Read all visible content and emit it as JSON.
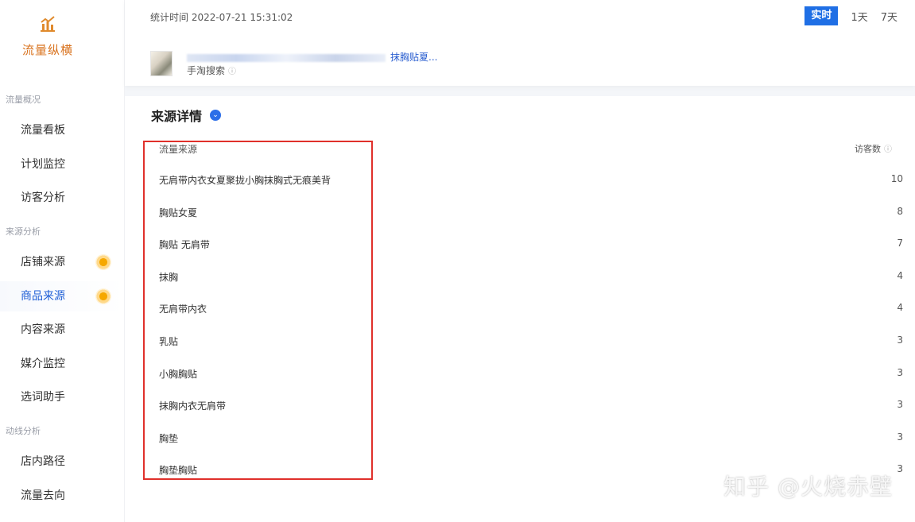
{
  "sidebar": {
    "brand_title": "流量纵横",
    "sections": [
      {
        "title": "流量概况",
        "items": [
          {
            "label": "流量看板"
          },
          {
            "label": "计划监控"
          },
          {
            "label": "访客分析"
          }
        ]
      },
      {
        "title": "来源分析",
        "items": [
          {
            "label": "店铺来源"
          },
          {
            "label": "商品来源"
          },
          {
            "label": "内容来源"
          },
          {
            "label": "媒介监控"
          },
          {
            "label": "选词助手"
          }
        ]
      },
      {
        "title": "动线分析",
        "items": [
          {
            "label": "店内路径"
          },
          {
            "label": "流量去向"
          }
        ]
      }
    ]
  },
  "header": {
    "stat_time": "统计时间 2022-07-21 15:31:02",
    "range_tabs": [
      "实时",
      "1天",
      "7天"
    ],
    "active_range": "实时"
  },
  "product": {
    "title_visible_suffix": "抹胸贴夏...",
    "source": "手淘搜索"
  },
  "detail": {
    "title": "来源详情",
    "columns": {
      "source": "流量来源",
      "visitors": "访客数"
    },
    "rows": [
      {
        "source": "无肩带内衣女夏聚拢小胸抹胸式无痕美背",
        "visitors": "10"
      },
      {
        "source": "胸贴女夏",
        "visitors": "8"
      },
      {
        "source": "胸贴 无肩带",
        "visitors": "7"
      },
      {
        "source": "抹胸",
        "visitors": "4"
      },
      {
        "source": "无肩带内衣",
        "visitors": "4"
      },
      {
        "source": "乳贴",
        "visitors": "3"
      },
      {
        "source": "小胸胸贴",
        "visitors": "3"
      },
      {
        "source": "抹胸内衣无肩带",
        "visitors": "3"
      },
      {
        "source": "胸垫",
        "visitors": "3"
      },
      {
        "source": "胸垫胸贴",
        "visitors": "3"
      }
    ]
  },
  "watermark": "知乎 @火烧赤壁",
  "colors": {
    "accent": "#1f6fe5",
    "brand": "#d9731f",
    "highlight": "#e0302b"
  }
}
